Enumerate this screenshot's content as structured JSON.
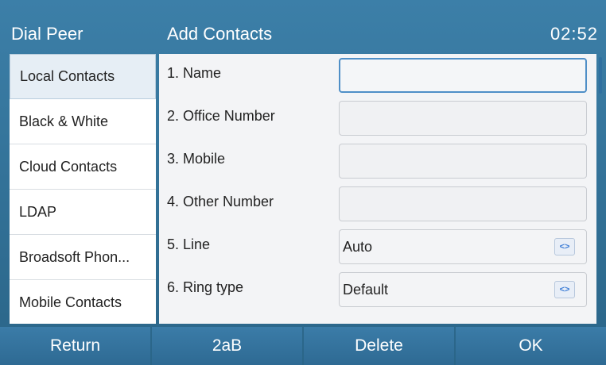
{
  "header": {
    "left_title": "Dial Peer",
    "title": "Add Contacts",
    "clock": "02:52"
  },
  "sidebar": {
    "items": [
      {
        "label": "Local Contacts"
      },
      {
        "label": "Black & White"
      },
      {
        "label": "Cloud Contacts"
      },
      {
        "label": "LDAP"
      },
      {
        "label": "Broadsoft Phon..."
      },
      {
        "label": "Mobile Contacts"
      }
    ]
  },
  "form": {
    "rows": [
      {
        "label": "1. Name",
        "value": ""
      },
      {
        "label": "2. Office Number",
        "value": ""
      },
      {
        "label": "3. Mobile",
        "value": ""
      },
      {
        "label": "4. Other Number",
        "value": ""
      },
      {
        "label": "5. Line",
        "value": "Auto"
      },
      {
        "label": "6. Ring type",
        "value": "Default"
      }
    ]
  },
  "softkeys": {
    "return": "Return",
    "input_mode": "2aB",
    "delete": "Delete",
    "ok": "OK"
  },
  "icons": {
    "select_arrows": "<>"
  }
}
